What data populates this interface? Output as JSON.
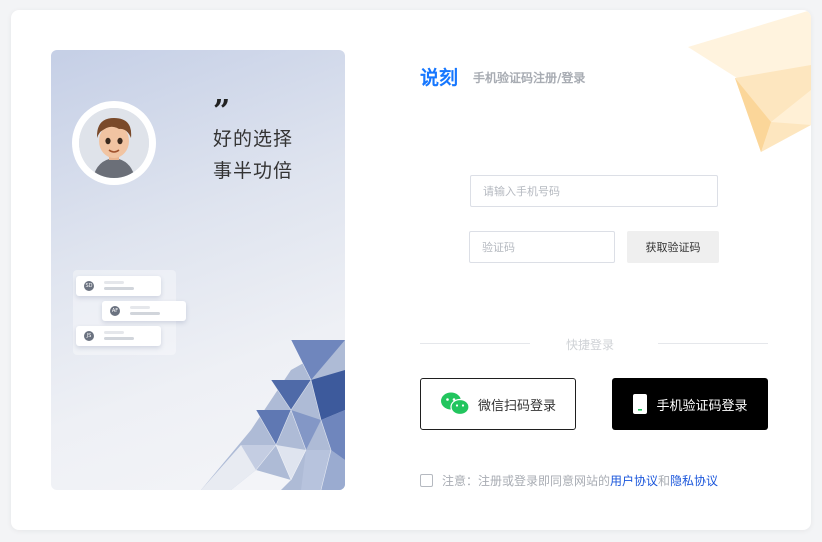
{
  "left_panel": {
    "quote_mark": "”",
    "slogan_line1": "好的选择",
    "slogan_line2": "事半功倍",
    "mini_cards": [
      "SD",
      "AF",
      "JS"
    ]
  },
  "header": {
    "brand": "说刻",
    "subtitle": "手机验证码注册/登录"
  },
  "form": {
    "phone_placeholder": "请输入手机号码",
    "code_placeholder": "验证码",
    "get_code_label": "获取验证码"
  },
  "quick_login": {
    "divider_label": "快捷登录",
    "wechat_label": "微信扫码登录",
    "phone_label": "手机验证码登录"
  },
  "agreement": {
    "prefix": "注意：注册或登录即同意网站的",
    "user_agreement": "用户协议",
    "and": "和",
    "privacy_agreement": "隐私协议"
  },
  "colors": {
    "brand": "#1677ff",
    "link": "#1a56db",
    "wechat": "#22c55e"
  }
}
